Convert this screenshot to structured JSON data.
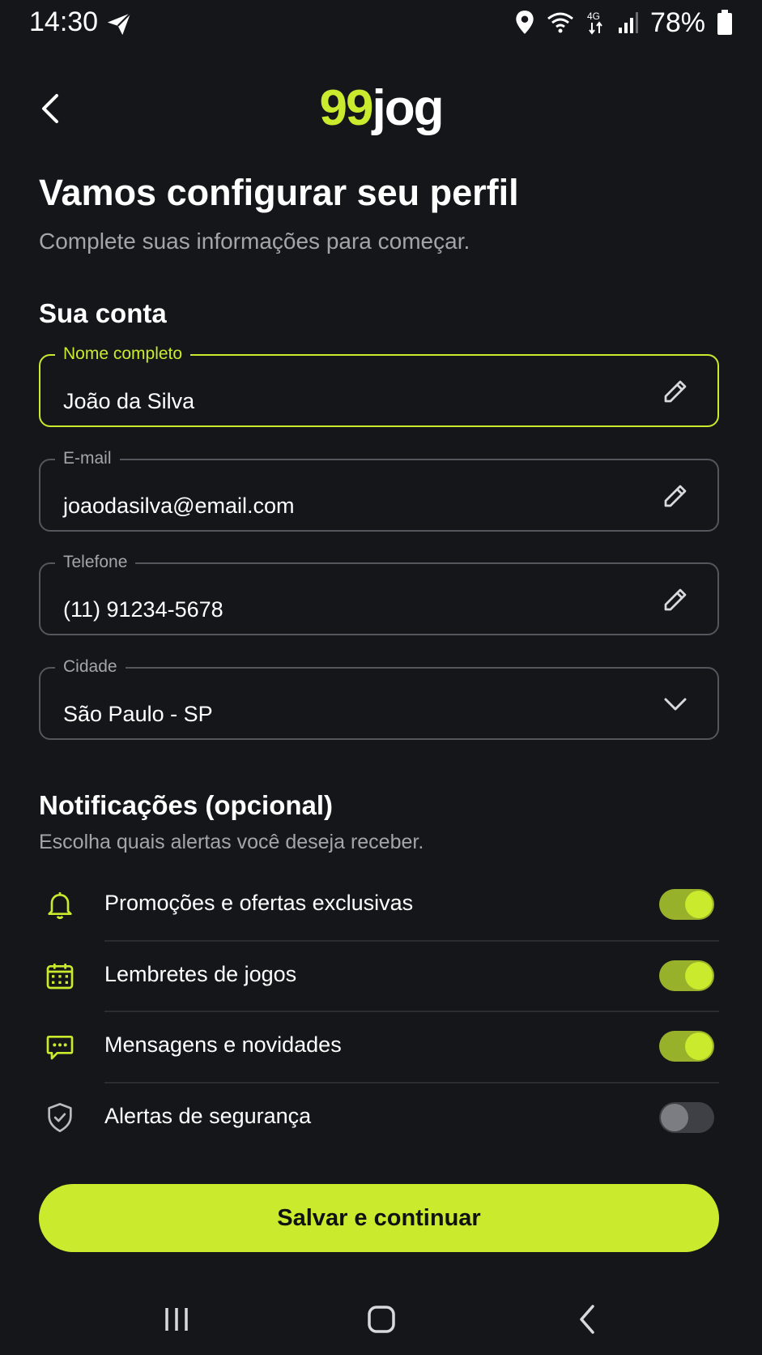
{
  "status_bar": {
    "time": "14:30",
    "battery": "78%",
    "icons": [
      "send-icon",
      "location-icon",
      "wifi-icon",
      "4g-icon",
      "signal-icon",
      "battery-icon"
    ]
  },
  "header": {
    "logo_part1": "99",
    "logo_part2": "jog",
    "back_icon": "chevron-left-icon"
  },
  "page": {
    "title": "Vamos configurar seu perfil",
    "subtitle": "Complete suas informações para começar."
  },
  "account": {
    "section_title": "Sua conta",
    "fields": [
      {
        "label": "Nome completo",
        "value": "João da Silva",
        "icon": "pencil-icon",
        "active": true
      },
      {
        "label": "E-mail",
        "value": "joaodasilva@email.com",
        "icon": "pencil-icon"
      },
      {
        "label": "Telefone",
        "value": "(11) 91234-5678",
        "icon": "pencil-icon"
      },
      {
        "label": "Cidade",
        "value": "São Paulo - SP",
        "icon": "chevron-down-icon"
      }
    ]
  },
  "notifications": {
    "section_title": "Notificações (opcional)",
    "subtitle": "Escolha quais alertas você deseja receber.",
    "items": [
      {
        "label": "Promoções e ofertas exclusivas",
        "icon": "bell-icon",
        "enabled": true
      },
      {
        "label": "Lembretes de jogos",
        "icon": "calendar-icon",
        "enabled": true
      },
      {
        "label": "Mensagens e novidades",
        "icon": "chat-icon",
        "enabled": true
      },
      {
        "label": "Alertas de segurança",
        "icon": "shield-icon",
        "enabled": false
      }
    ]
  },
  "save_button": {
    "label": "Salvar e continuar"
  },
  "nav_bar": {
    "icons": [
      "recent-apps-icon",
      "home-icon",
      "back-icon"
    ]
  },
  "colors": {
    "background": "#15161a",
    "accent": "#c9ea2d",
    "muted_text": "#a3a5aa",
    "border": "#53565c"
  }
}
